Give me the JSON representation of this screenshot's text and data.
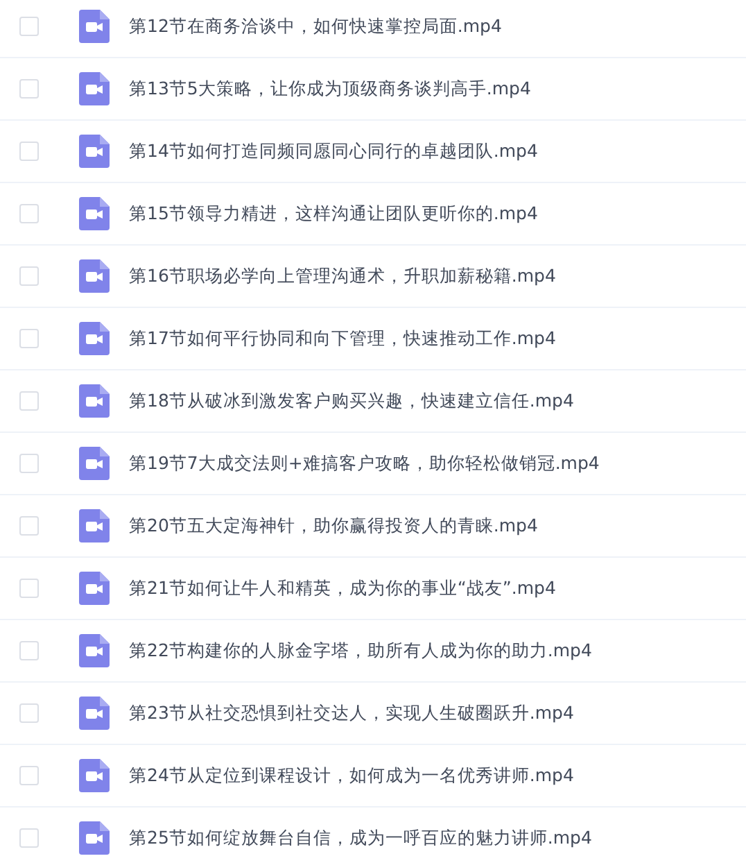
{
  "files": [
    {
      "name": "第12节在商务洽谈中，如何快速掌控局面.mp4",
      "checked": false
    },
    {
      "name": "第13节5大策略，让你成为顶级商务谈判高手.mp4",
      "checked": false
    },
    {
      "name": "第14节如何打造同频同愿同心同行的卓越团队.mp4",
      "checked": false
    },
    {
      "name": "第15节领导力精进，这样沟通让团队更听你的.mp4",
      "checked": false
    },
    {
      "name": "第16节职场必学向上管理沟通术，升职加薪秘籍.mp4",
      "checked": false
    },
    {
      "name": "第17节如何平行协同和向下管理，快速推动工作.mp4",
      "checked": false
    },
    {
      "name": "第18节从破冰到激发客户购买兴趣，快速建立信任.mp4",
      "checked": false
    },
    {
      "name": "第19节7大成交法则+难搞客户攻略，助你轻松做销冠.mp4",
      "checked": false
    },
    {
      "name": "第20节五大定海神针，助你赢得投资人的青睐.mp4",
      "checked": false
    },
    {
      "name": "第21节如何让牛人和精英，成为你的事业“战友”.mp4",
      "checked": false
    },
    {
      "name": "第22节构建你的人脉金字塔，助所有人成为你的助力.mp4",
      "checked": false
    },
    {
      "name": "第23节从社交恐惧到社交达人，实现人生破圈跃升.mp4",
      "checked": false
    },
    {
      "name": "第24节从定位到课程设计，如何成为一名优秀讲师.mp4",
      "checked": false
    },
    {
      "name": "第25节如何绽放舞台自信，成为一呼百应的魅力讲师.mp4",
      "checked": false
    }
  ]
}
